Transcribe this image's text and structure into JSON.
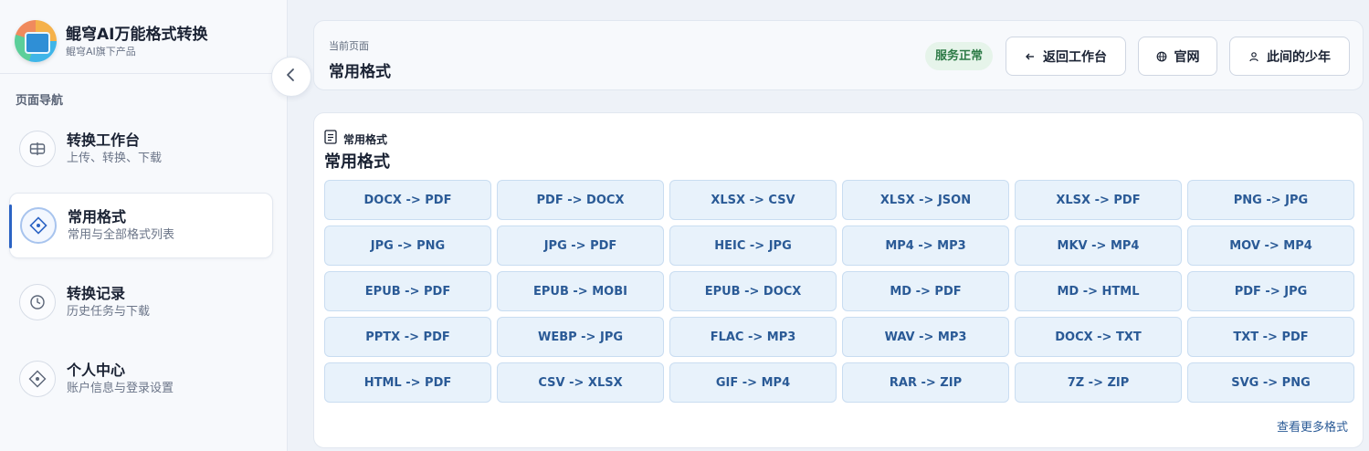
{
  "brand": {
    "title": "鲲穹AI万能格式转换",
    "subtitle": "鲲穹AI旗下产品"
  },
  "sidebar": {
    "heading": "页面导航",
    "items": [
      {
        "label": "转换工作台",
        "desc": "上传、转换、下载",
        "icon": "grid-icon"
      },
      {
        "label": "常用格式",
        "desc": "常用与全部格式列表",
        "icon": "diamond-icon",
        "active": true
      },
      {
        "label": "转换记录",
        "desc": "历史任务与下载",
        "icon": "clock-icon"
      },
      {
        "label": "个人中心",
        "desc": "账户信息与登录设置",
        "icon": "diamond-icon"
      }
    ]
  },
  "header": {
    "crumb": "当前页面",
    "title": "常用格式",
    "status": "服务正常",
    "buttons": {
      "back": "返回工作台",
      "site": "官网",
      "user": "此间的少年"
    }
  },
  "main": {
    "section_label": "常用格式",
    "title": "常用格式",
    "formats": [
      "DOCX -> PDF",
      "PDF -> DOCX",
      "XLSX -> CSV",
      "XLSX -> JSON",
      "XLSX -> PDF",
      "PNG -> JPG",
      "JPG -> PNG",
      "JPG -> PDF",
      "HEIC -> JPG",
      "MP4 -> MP3",
      "MKV -> MP4",
      "MOV -> MP4",
      "EPUB -> PDF",
      "EPUB -> MOBI",
      "EPUB -> DOCX",
      "MD -> PDF",
      "MD -> HTML",
      "PDF -> JPG",
      "PPTX -> PDF",
      "WEBP -> JPG",
      "FLAC -> MP3",
      "WAV -> MP3",
      "DOCX -> TXT",
      "TXT -> PDF",
      "HTML -> PDF",
      "CSV -> XLSX",
      "GIF -> MP4",
      "RAR -> ZIP",
      "7Z -> ZIP",
      "SVG -> PNG"
    ],
    "more_link": "查看更多格式"
  },
  "colors": {
    "accent": "#2b63c4",
    "chip_bg": "#e8f2fb",
    "chip_text": "#2a5a96",
    "status_bg": "#e6f4ea",
    "status_text": "#2d7a46"
  }
}
